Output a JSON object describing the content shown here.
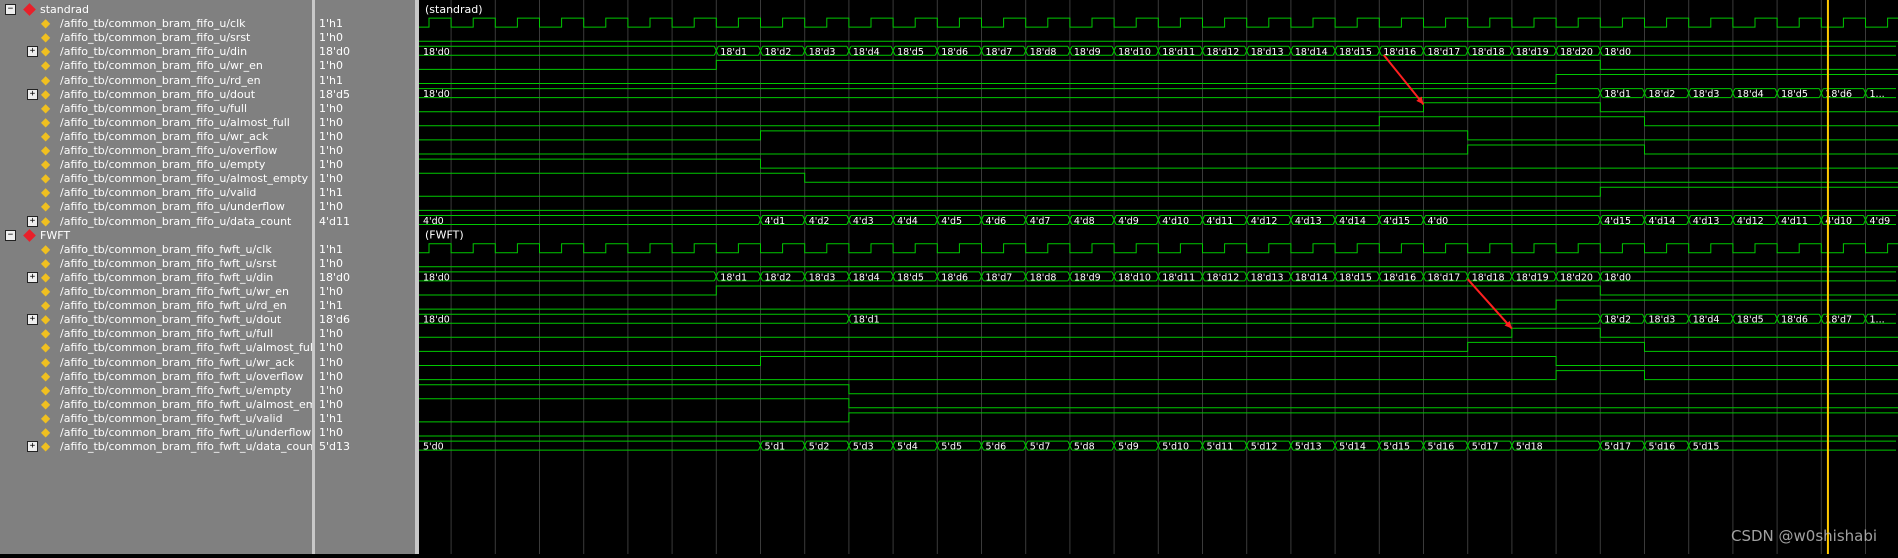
{
  "groups": [
    {
      "name": "standrad",
      "label": "(standrad)",
      "signals": [
        {
          "name": "/afifo_tb/common_bram_fifo_u/clk",
          "value": "1'h1",
          "bus": false
        },
        {
          "name": "/afifo_tb/common_bram_fifo_u/srst",
          "value": "1'h0",
          "bus": false
        },
        {
          "name": "/afifo_tb/common_bram_fifo_u/din",
          "value": "18'd0",
          "bus": true
        },
        {
          "name": "/afifo_tb/common_bram_fifo_u/wr_en",
          "value": "1'h0",
          "bus": false
        },
        {
          "name": "/afifo_tb/common_bram_fifo_u/rd_en",
          "value": "1'h1",
          "bus": false
        },
        {
          "name": "/afifo_tb/common_bram_fifo_u/dout",
          "value": "18'd5",
          "bus": true
        },
        {
          "name": "/afifo_tb/common_bram_fifo_u/full",
          "value": "1'h0",
          "bus": false
        },
        {
          "name": "/afifo_tb/common_bram_fifo_u/almost_full",
          "value": "1'h0",
          "bus": false
        },
        {
          "name": "/afifo_tb/common_bram_fifo_u/wr_ack",
          "value": "1'h0",
          "bus": false
        },
        {
          "name": "/afifo_tb/common_bram_fifo_u/overflow",
          "value": "1'h0",
          "bus": false
        },
        {
          "name": "/afifo_tb/common_bram_fifo_u/empty",
          "value": "1'h0",
          "bus": false
        },
        {
          "name": "/afifo_tb/common_bram_fifo_u/almost_empty",
          "value": "1'h0",
          "bus": false
        },
        {
          "name": "/afifo_tb/common_bram_fifo_u/valid",
          "value": "1'h1",
          "bus": false
        },
        {
          "name": "/afifo_tb/common_bram_fifo_u/underflow",
          "value": "1'h0",
          "bus": false
        },
        {
          "name": "/afifo_tb/common_bram_fifo_u/data_count",
          "value": "4'd11",
          "bus": true
        }
      ]
    },
    {
      "name": "FWFT",
      "label": "(FWFT)",
      "signals": [
        {
          "name": "/afifo_tb/common_bram_fifo_fwft_u/clk",
          "value": "1'h1",
          "bus": false
        },
        {
          "name": "/afifo_tb/common_bram_fifo_fwft_u/srst",
          "value": "1'h0",
          "bus": false
        },
        {
          "name": "/afifo_tb/common_bram_fifo_fwft_u/din",
          "value": "18'd0",
          "bus": true
        },
        {
          "name": "/afifo_tb/common_bram_fifo_fwft_u/wr_en",
          "value": "1'h0",
          "bus": false
        },
        {
          "name": "/afifo_tb/common_bram_fifo_fwft_u/rd_en",
          "value": "1'h1",
          "bus": false
        },
        {
          "name": "/afifo_tb/common_bram_fifo_fwft_u/dout",
          "value": "18'd6",
          "bus": true
        },
        {
          "name": "/afifo_tb/common_bram_fifo_fwft_u/full",
          "value": "1'h0",
          "bus": false
        },
        {
          "name": "/afifo_tb/common_bram_fifo_fwft_u/almost_full",
          "value": "1'h0",
          "bus": false
        },
        {
          "name": "/afifo_tb/common_bram_fifo_fwft_u/wr_ack",
          "value": "1'h0",
          "bus": false
        },
        {
          "name": "/afifo_tb/common_bram_fifo_fwft_u/overflow",
          "value": "1'h0",
          "bus": false
        },
        {
          "name": "/afifo_tb/common_bram_fifo_fwft_u/empty",
          "value": "1'h0",
          "bus": false
        },
        {
          "name": "/afifo_tb/common_bram_fifo_fwft_u/almost_empty",
          "value": "1'h0",
          "bus": false
        },
        {
          "name": "/afifo_tb/common_bram_fifo_fwft_u/valid",
          "value": "1'h1",
          "bus": false
        },
        {
          "name": "/afifo_tb/common_bram_fifo_fwft_u/underflow",
          "value": "1'h0",
          "bus": false
        },
        {
          "name": "/afifo_tb/common_bram_fifo_fwft_u/data_count",
          "value": "5'd13",
          "bus": true
        }
      ]
    }
  ],
  "waves": {
    "standrad": {
      "clk": {
        "type": "clock"
      },
      "srst": {
        "type": "bit",
        "init": 0,
        "changes": []
      },
      "din": {
        "type": "bus",
        "segments": [
          [
            0,
            "18'd0"
          ],
          [
            6.5,
            "18'd1"
          ],
          [
            7.5,
            "18'd2"
          ],
          [
            8.5,
            "18'd3"
          ],
          [
            9.5,
            "18'd4"
          ],
          [
            10.5,
            "18'd5"
          ],
          [
            11.5,
            "18'd6"
          ],
          [
            12.5,
            "18'd7"
          ],
          [
            13.5,
            "18'd8"
          ],
          [
            14.5,
            "18'd9"
          ],
          [
            15.5,
            "18'd10"
          ],
          [
            16.5,
            "18'd11"
          ],
          [
            17.5,
            "18'd12"
          ],
          [
            18.5,
            "18'd13"
          ],
          [
            19.5,
            "18'd14"
          ],
          [
            20.5,
            "18'd15"
          ],
          [
            21.5,
            "18'd16"
          ],
          [
            22.5,
            "18'd17"
          ],
          [
            23.5,
            "18'd18"
          ],
          [
            24.5,
            "18'd19"
          ],
          [
            25.5,
            "18'd20"
          ],
          [
            26.5,
            "18'd0"
          ]
        ]
      },
      "wr_en": {
        "type": "bit",
        "init": 0,
        "changes": [
          6.5,
          26.5
        ]
      },
      "rd_en": {
        "type": "bit",
        "init": 0,
        "changes": [
          25.5
        ]
      },
      "dout": {
        "type": "bus",
        "segments": [
          [
            0,
            "18'd0"
          ],
          [
            26.5,
            "18'd1"
          ],
          [
            27.5,
            "18'd2"
          ],
          [
            28.5,
            "18'd3"
          ],
          [
            29.5,
            "18'd4"
          ],
          [
            30.5,
            "18'd5"
          ],
          [
            31.5,
            "18'd6"
          ],
          [
            32.5,
            "1..."
          ]
        ]
      },
      "full": {
        "type": "bit",
        "init": 0,
        "changes": [
          22.5,
          26.5
        ]
      },
      "almost_full": {
        "type": "bit",
        "init": 0,
        "changes": [
          21.5,
          27.5
        ]
      },
      "wr_ack": {
        "type": "bit",
        "init": 0,
        "changes": [
          7.5,
          23.5
        ]
      },
      "overflow": {
        "type": "bit",
        "init": 0,
        "changes": [
          23.5,
          27.5
        ]
      },
      "empty": {
        "type": "bit",
        "init": 1,
        "changes": [
          7.5
        ]
      },
      "almost_empty": {
        "type": "bit",
        "init": 1,
        "changes": [
          8.5
        ]
      },
      "valid": {
        "type": "bit",
        "init": 0,
        "changes": [
          26.5
        ]
      },
      "underflow": {
        "type": "bit",
        "init": 0,
        "changes": []
      },
      "data_count": {
        "type": "bus",
        "segments": [
          [
            0,
            "4'd0"
          ],
          [
            7.5,
            "4'd1"
          ],
          [
            8.5,
            "4'd2"
          ],
          [
            9.5,
            "4'd3"
          ],
          [
            10.5,
            "4'd4"
          ],
          [
            11.5,
            "4'd5"
          ],
          [
            12.5,
            "4'd6"
          ],
          [
            13.5,
            "4'd7"
          ],
          [
            14.5,
            "4'd8"
          ],
          [
            15.5,
            "4'd9"
          ],
          [
            16.5,
            "4'd10"
          ],
          [
            17.5,
            "4'd11"
          ],
          [
            18.5,
            "4'd12"
          ],
          [
            19.5,
            "4'd13"
          ],
          [
            20.5,
            "4'd14"
          ],
          [
            21.5,
            "4'd15"
          ],
          [
            22.5,
            "4'd0"
          ],
          [
            26.5,
            "4'd15"
          ],
          [
            27.5,
            "4'd14"
          ],
          [
            28.5,
            "4'd13"
          ],
          [
            29.5,
            "4'd12"
          ],
          [
            30.5,
            "4'd11"
          ],
          [
            31.5,
            "4'd10"
          ],
          [
            32.5,
            "4'd9"
          ]
        ]
      }
    },
    "FWFT": {
      "clk": {
        "type": "clock"
      },
      "srst": {
        "type": "bit",
        "init": 0,
        "changes": []
      },
      "din": {
        "type": "bus",
        "segments": [
          [
            0,
            "18'd0"
          ],
          [
            6.5,
            "18'd1"
          ],
          [
            7.5,
            "18'd2"
          ],
          [
            8.5,
            "18'd3"
          ],
          [
            9.5,
            "18'd4"
          ],
          [
            10.5,
            "18'd5"
          ],
          [
            11.5,
            "18'd6"
          ],
          [
            12.5,
            "18'd7"
          ],
          [
            13.5,
            "18'd8"
          ],
          [
            14.5,
            "18'd9"
          ],
          [
            15.5,
            "18'd10"
          ],
          [
            16.5,
            "18'd11"
          ],
          [
            17.5,
            "18'd12"
          ],
          [
            18.5,
            "18'd13"
          ],
          [
            19.5,
            "18'd14"
          ],
          [
            20.5,
            "18'd15"
          ],
          [
            21.5,
            "18'd16"
          ],
          [
            22.5,
            "18'd17"
          ],
          [
            23.5,
            "18'd18"
          ],
          [
            24.5,
            "18'd19"
          ],
          [
            25.5,
            "18'd20"
          ],
          [
            26.5,
            "18'd0"
          ]
        ]
      },
      "wr_en": {
        "type": "bit",
        "init": 0,
        "changes": [
          6.5,
          26.5
        ]
      },
      "rd_en": {
        "type": "bit",
        "init": 0,
        "changes": [
          25.5
        ]
      },
      "dout": {
        "type": "bus",
        "segments": [
          [
            0,
            "18'd0"
          ],
          [
            9.5,
            "18'd1"
          ],
          [
            26.5,
            "18'd2"
          ],
          [
            27.5,
            "18'd3"
          ],
          [
            28.5,
            "18'd4"
          ],
          [
            29.5,
            "18'd5"
          ],
          [
            30.5,
            "18'd6"
          ],
          [
            31.5,
            "18'd7"
          ],
          [
            32.5,
            "1..."
          ]
        ]
      },
      "full": {
        "type": "bit",
        "init": 0,
        "changes": [
          24.5,
          26.5
        ]
      },
      "almost_full": {
        "type": "bit",
        "init": 0,
        "changes": [
          23.5,
          27.5
        ]
      },
      "wr_ack": {
        "type": "bit",
        "init": 0,
        "changes": [
          7.5,
          25.5
        ]
      },
      "overflow": {
        "type": "bit",
        "init": 0,
        "changes": [
          25.5,
          27.5
        ]
      },
      "empty": {
        "type": "bit",
        "init": 1,
        "changes": [
          9.5
        ]
      },
      "almost_empty": {
        "type": "bit",
        "init": 1,
        "changes": [
          9.5
        ]
      },
      "valid": {
        "type": "bit",
        "init": 0,
        "changes": [
          9.5
        ]
      },
      "underflow": {
        "type": "bit",
        "init": 0,
        "changes": []
      },
      "data_count": {
        "type": "bus",
        "segments": [
          [
            0,
            "5'd0"
          ],
          [
            7.5,
            "5'd1"
          ],
          [
            8.5,
            "5'd2"
          ],
          [
            9.5,
            "5'd3"
          ],
          [
            10.5,
            "5'd4"
          ],
          [
            11.5,
            "5'd5"
          ],
          [
            12.5,
            "5'd6"
          ],
          [
            13.5,
            "5'd7"
          ],
          [
            14.5,
            "5'd8"
          ],
          [
            15.5,
            "5'd9"
          ],
          [
            16.5,
            "5'd10"
          ],
          [
            17.5,
            "5'd11"
          ],
          [
            18.5,
            "5'd12"
          ],
          [
            19.5,
            "5'd13"
          ],
          [
            20.5,
            "5'd14"
          ],
          [
            21.5,
            "5'd15"
          ],
          [
            22.5,
            "5'd16"
          ],
          [
            23.5,
            "5'd17"
          ],
          [
            24.5,
            "5'd18"
          ],
          [
            26.5,
            "5'd17"
          ],
          [
            27.5,
            "5'd16"
          ],
          [
            28.5,
            "5'd15"
          ]
        ]
      }
    }
  },
  "colors": {
    "wave": "#00c800",
    "cursor": "#ffc800",
    "marker": "#ff2020",
    "grid": "#3a3a3a"
  },
  "watermark": "CSDN @w0shishabi"
}
